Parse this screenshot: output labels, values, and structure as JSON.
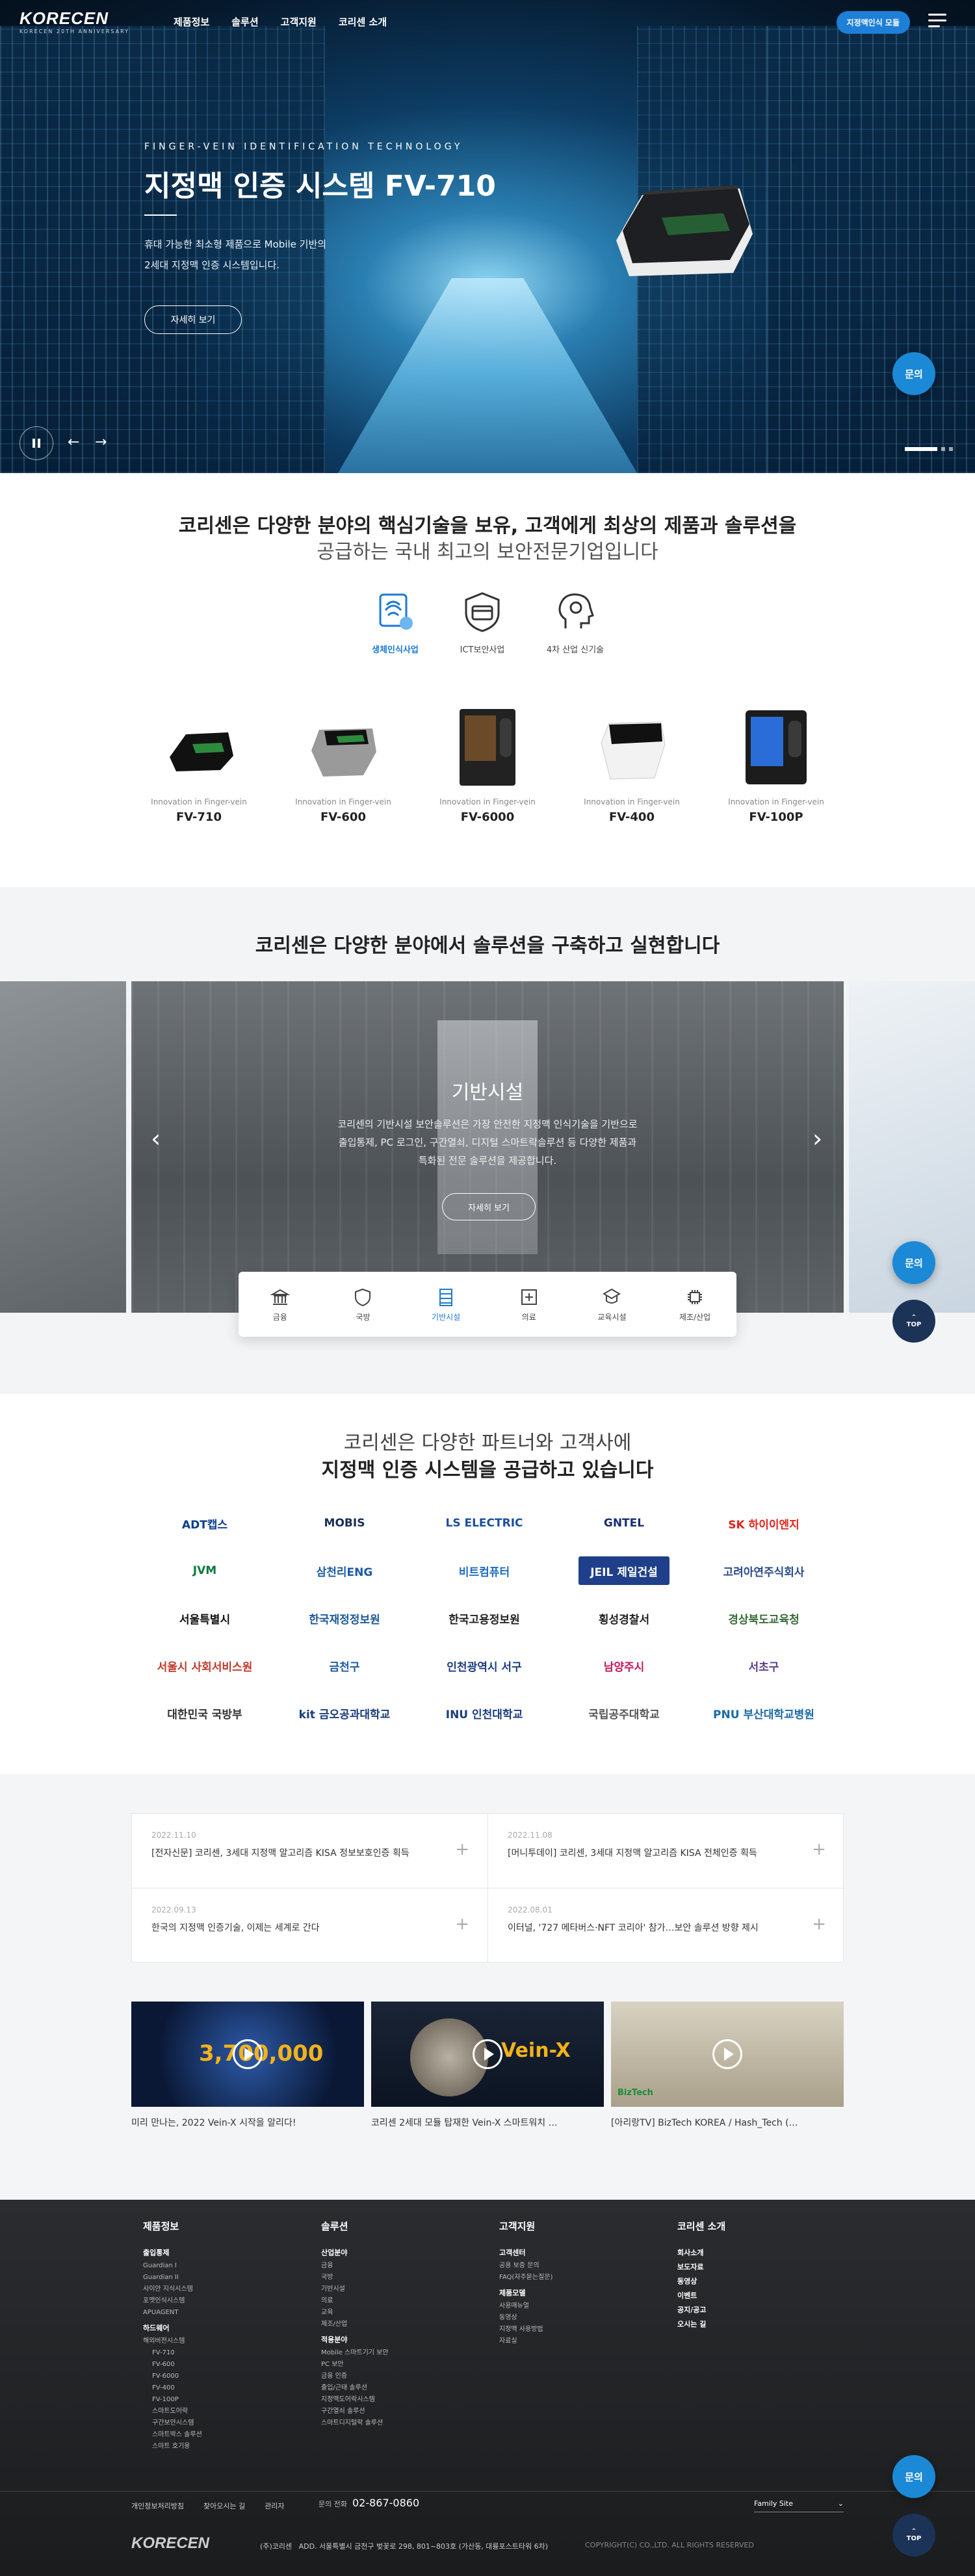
{
  "header": {
    "logo_text": "KORECEN",
    "logo_sub": "KORECEN 20TH ANNIVERSARY",
    "nav": [
      "제품정보",
      "솔루션",
      "고객지원",
      "코리센 소개"
    ],
    "cta": "지정맥인식 모듈"
  },
  "hero": {
    "sub": "FINGER-VEIN IDENTIFICATION TECHNOLOGY",
    "title": "지정맥 인증 시스템 FV-710",
    "desc1": "휴대 가능한 최소형 제품으로 Mobile 기반의",
    "desc2": "2세대 지정맥 인증 시스템입니다.",
    "more": "자세히 보기"
  },
  "fab": {
    "inquiry": "문의",
    "top": "TOP"
  },
  "intro": {
    "line1": "코리센은 다양한 분야의 핵심기술을 보유, 고객에게 최상의 제품과 솔루션을",
    "line2": "공급하는 국내 최고의 보안전문기업입니다"
  },
  "business": [
    {
      "label": "생체인식사업",
      "icon": "fingerprint-icon",
      "active": true
    },
    {
      "label": "ICT보안사업",
      "icon": "card-shield-icon",
      "active": false
    },
    {
      "label": "4차 산업 신기술",
      "icon": "head-gear-icon",
      "active": false
    }
  ],
  "products": [
    {
      "cap": "Innovation in Finger-vein",
      "name": "FV-710"
    },
    {
      "cap": "Innovation in Finger-vein",
      "name": "FV-600"
    },
    {
      "cap": "Innovation in Finger-vein",
      "name": "FV-6000"
    },
    {
      "cap": "Innovation in Finger-vein",
      "name": "FV-400"
    },
    {
      "cap": "Innovation in Finger-vein",
      "name": "FV-100P"
    }
  ],
  "solutions": {
    "title": "코리센은 다양한 분야에서 솔루션을 구축하고 실현합니다",
    "slide_title": "기반시설",
    "desc1": "코리센의 기반시설 보안솔루션은 가장 안전한 지정맥 인식기술을 기반으로",
    "desc2": "출입통제, PC 로그인, 구간열쇠, 디지털 스마트락솔루션 등 다양한 제품과",
    "desc3": "특화된 전문 솔루션을 제공합니다.",
    "more": "자세히 보기",
    "tabs": [
      {
        "label": "금융",
        "icon": "bank-icon"
      },
      {
        "label": "국방",
        "icon": "shield-icon"
      },
      {
        "label": "기반시설",
        "icon": "building-icon"
      },
      {
        "label": "의료",
        "icon": "medical-icon"
      },
      {
        "label": "교육시설",
        "icon": "school-icon"
      },
      {
        "label": "제조/산업",
        "icon": "chip-icon"
      }
    ],
    "active_tab": "기반시설"
  },
  "partners": {
    "line1": "코리센은 다양한 파트너와 고객사에",
    "line2": "지정맥 인증 시스템을 공급하고 있습니다",
    "logos": [
      {
        "text": "ADT캡스",
        "color": "#0a3e8c"
      },
      {
        "text": "MOBIS",
        "color": "#1a2c55"
      },
      {
        "text": "LS ELECTRIC",
        "color": "#1c4da1"
      },
      {
        "text": "GNTEL",
        "color": "#1a2c70"
      },
      {
        "text": "SK 하이이엔지",
        "color": "#e2231a"
      },
      {
        "text": "JVM",
        "color": "#0d7a3e"
      },
      {
        "text": "삼천리ENG",
        "color": "#1a5aa6"
      },
      {
        "text": "비트컴퓨터",
        "color": "#1f6cc1"
      },
      {
        "text": "JEIL 제일건설",
        "color": "#ffffff"
      },
      {
        "text": "고려아연주식회사",
        "color": "#2a4b8d"
      },
      {
        "text": "서울특별시",
        "color": "#111111"
      },
      {
        "text": "한국재정정보원",
        "color": "#1d5a97"
      },
      {
        "text": "한국고용정보원",
        "color": "#222222"
      },
      {
        "text": "횡성경찰서",
        "color": "#222222"
      },
      {
        "text": "경상북도교육청",
        "color": "#3a6b3a"
      },
      {
        "text": "서울시 사회서비스원",
        "color": "#c0392b"
      },
      {
        "text": "금천구",
        "color": "#1a5aa6"
      },
      {
        "text": "인천광역시 서구",
        "color": "#1a3c7c"
      },
      {
        "text": "남양주시",
        "color": "#c2185b"
      },
      {
        "text": "서초구",
        "color": "#5a3d8c"
      },
      {
        "text": "대한민국 국방부",
        "color": "#333333"
      },
      {
        "text": "kit 금오공과대학교",
        "color": "#1a3c7c"
      },
      {
        "text": "INU 인천대학교",
        "color": "#1a3c7c"
      },
      {
        "text": "국립공주대학교",
        "color": "#555555"
      },
      {
        "text": "PNU 부산대학교병원",
        "color": "#1b6aa5"
      }
    ]
  },
  "news": [
    {
      "date": "2022.11.10",
      "text": "[전자신문] 코리센, 3세대 지정맥 알고리즘 KISA 정보보호인증 획득"
    },
    {
      "date": "2022.11.08",
      "text": "[머니투데이] 코리센, 3세대 지정맥 알고리즘 KISA 전체인증 획득"
    },
    {
      "date": "2022.09.13",
      "text": "한국의 지정맥 인증기술, 이제는 세계로 간다"
    },
    {
      "date": "2022.08.01",
      "text": "이터널, '727 메타버스·NFT 코리아' 참가…보안 솔루션 방향 제시"
    }
  ],
  "videos": [
    {
      "cap": "미리 만나는, 2022 Vein-X 시작을 알리다!",
      "overlay": "3,700,000"
    },
    {
      "cap": "코리센 2세대 모듈 탑재한 Vein-X 스마트워치 …",
      "overlay": "Vein-X"
    },
    {
      "cap": "[아리랑TV] BizTech KOREA / Hash_Tech (…",
      "overlay": "BizTech"
    }
  ],
  "footer": {
    "cols": [
      {
        "head": "제품정보",
        "groups": [
          {
            "sub": "출입통제",
            "items": [
              "Guardian I",
              "Guardian II",
              "사이안 지식시스템",
              "포맷인식시스템",
              "APUAGENT"
            ]
          },
          {
            "sub": "하드웨어",
            "items": [
              "해외버전시스템"
            ],
            "sub_items": [
              "FV-710",
              "FV-600",
              "FV-6000",
              "FV-400",
              "FV-100P",
              "스마트도어락",
              "구간보안시스템",
              "스마트박스 솔루션",
              "스마트 호기용"
            ]
          }
        ]
      },
      {
        "head": "솔루션",
        "groups": [
          {
            "sub": "산업분야",
            "items": [
              "금융",
              "국방",
              "기반시설",
              "의료",
              "교육",
              "제조/산업"
            ]
          },
          {
            "sub": "적용분야",
            "items": [
              "Mobile 스마트기기 보안",
              "PC 보안",
              "금융 인증",
              "출입/근태 솔루션",
              "지정맥도어락시스템",
              "구간열쇠 솔루션",
              "스마트디지털락 솔루션"
            ]
          }
        ]
      },
      {
        "head": "고객지원",
        "groups": [
          {
            "sub": "고객센터",
            "items": [
              "공용 보증 문의",
              "FAQ(자주묻는질문)"
            ]
          },
          {
            "sub": "제품모델",
            "items": [
              "사용매뉴얼",
              "동영상",
              "지정맥 사용방법",
              "자료실"
            ]
          }
        ]
      },
      {
        "head": "코리센 소개",
        "groups": [
          {
            "sub": "회사소개",
            "items": []
          },
          {
            "sub": "보도자료",
            "items": []
          },
          {
            "sub": "동영상",
            "items": []
          },
          {
            "sub": "이벤트",
            "items": []
          },
          {
            "sub": "공지/공고",
            "items": []
          },
          {
            "sub": "오시는 길",
            "items": []
          }
        ]
      }
    ],
    "links": [
      "개인정보처리방침",
      "찾아오시는 길",
      "관리자"
    ],
    "phone_label": "문의 전화",
    "phone": "02-867-0860",
    "family": "Family Site",
    "company": "(주)코리센",
    "address": "ADD. 서울특별시 금천구 벚꽃로 298, 801~803호 (가산동, 대륭포스트타워 6차)",
    "copyright": "COPYRIGHT(C) CO.,LTD. ALL RIGHTS RESERVED"
  }
}
